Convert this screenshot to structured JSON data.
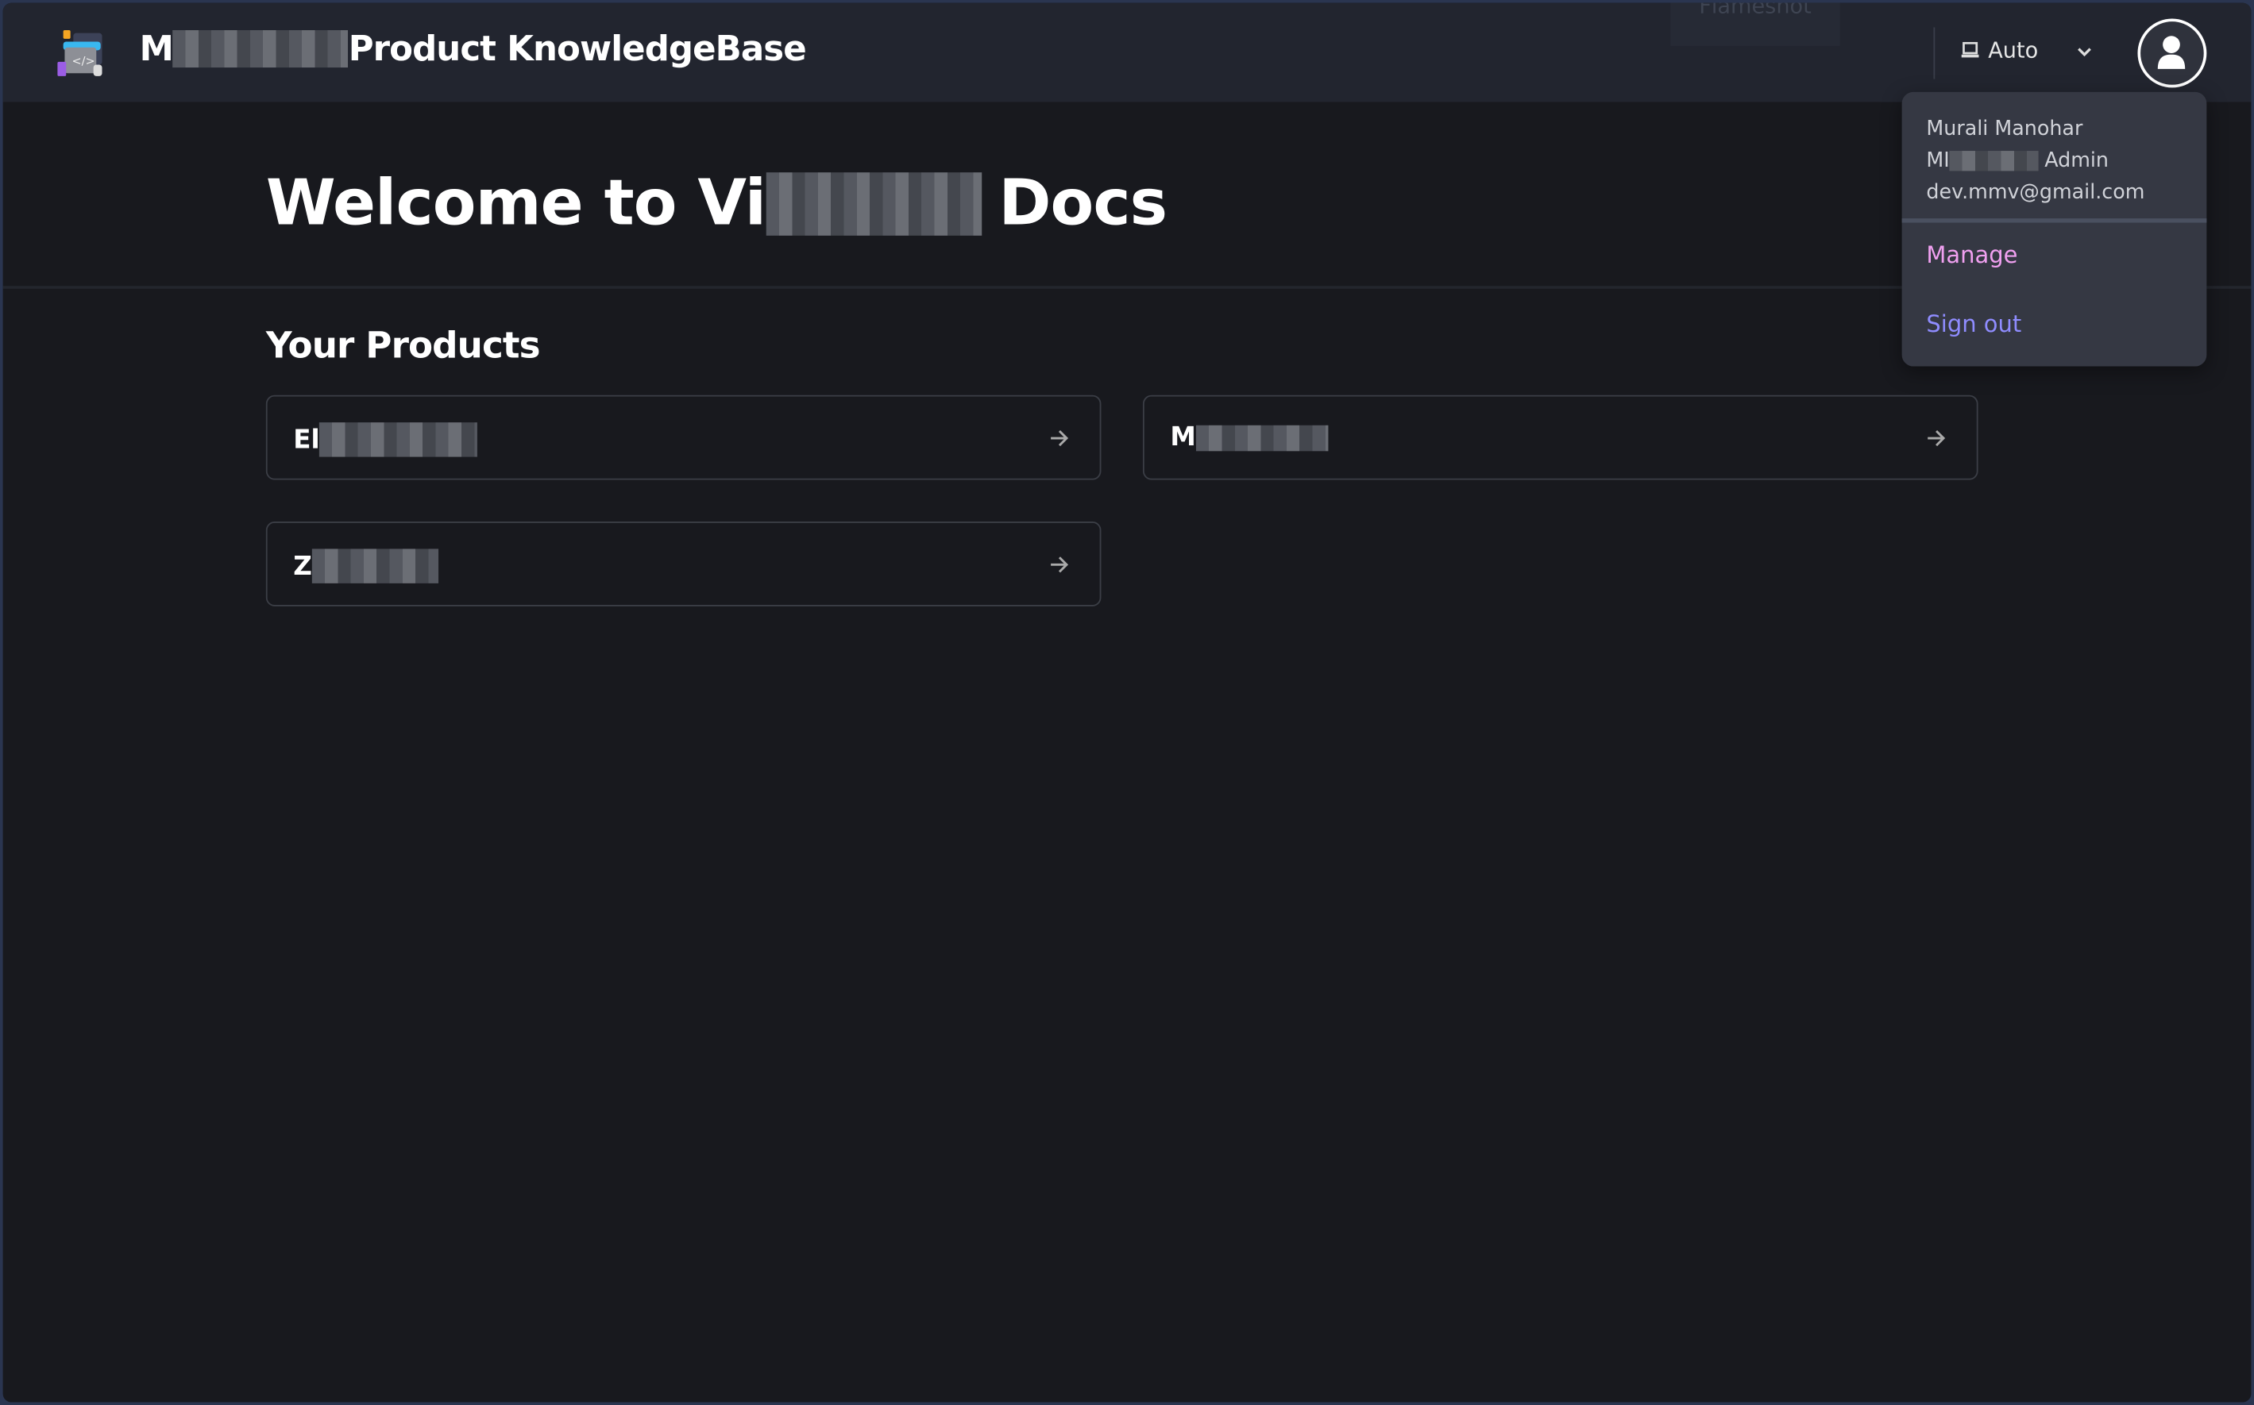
{
  "header": {
    "title_prefix": "M",
    "title_suffix": "Product KnowledgeBase",
    "logo_icon": "code-docs-logo",
    "tooltip": "Flameshot",
    "theme_label": "Auto",
    "theme_icon": "laptop-icon"
  },
  "user_menu": {
    "name": "Murali Manohar",
    "role_prefix": "MI",
    "role_suffix": "Admin",
    "email": "dev.mmv@gmail.com",
    "manage_label": "Manage",
    "signout_label": "Sign out",
    "manage_color": "#f0a0f0",
    "signout_color": "#8f8cff"
  },
  "main": {
    "welcome_prefix": "Welcome to Vi",
    "welcome_suffix": "Docs",
    "section_title": "Your Products",
    "products": [
      {
        "label": "El"
      },
      {
        "label": "M"
      },
      {
        "label": "Z"
      }
    ]
  }
}
